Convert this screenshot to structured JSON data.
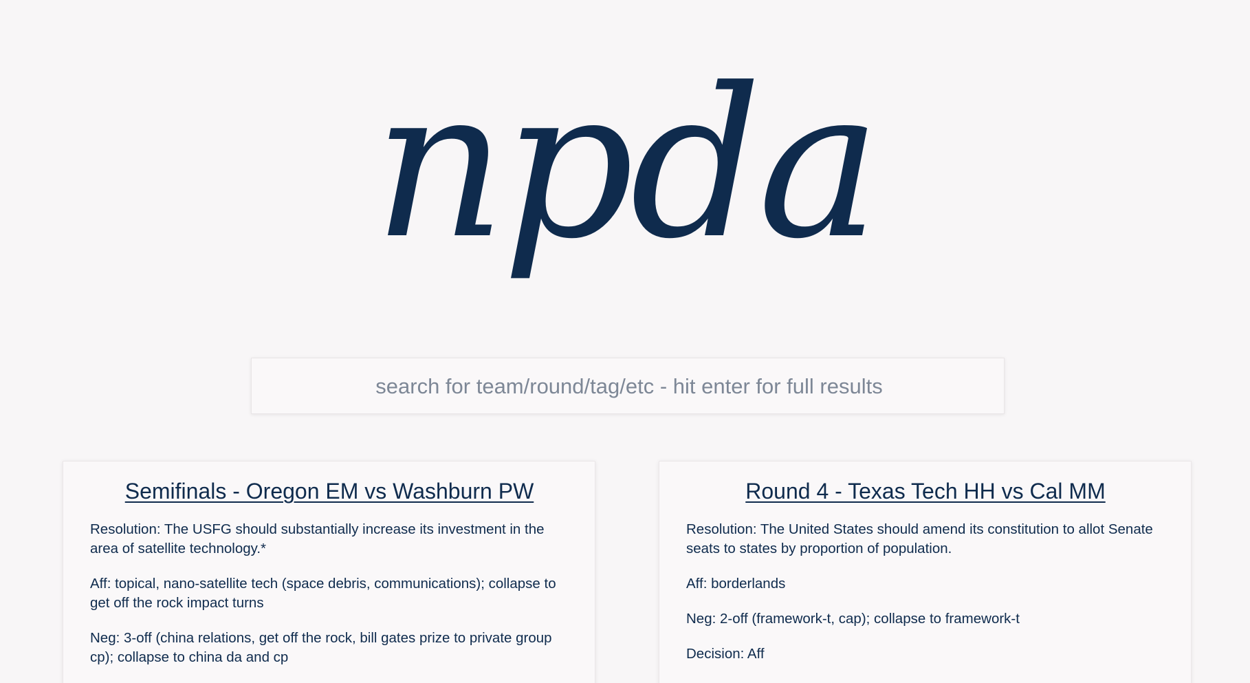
{
  "logo": {
    "text": "npda"
  },
  "search": {
    "placeholder": "search for team/round/tag/etc - hit enter for full results",
    "value": ""
  },
  "cards": [
    {
      "title": "Semifinals - Oregon EM vs Washburn PW",
      "resolution": "Resolution: The USFG should substantially increase its investment in the area of satellite technology.*",
      "aff": "Aff: topical, nano-satellite tech (space debris, communications); collapse to get off the rock impact turns",
      "neg": "Neg: 3-off (china relations, get off the rock, bill gates prize to private group cp); collapse to china da and cp"
    },
    {
      "title": "Round 4 - Texas Tech HH vs Cal MM",
      "resolution": "Resolution: The United States should amend its constitution to allot Senate seats to states by proportion of population.",
      "aff": "Aff: borderlands",
      "neg": "Neg: 2-off (framework-t, cap); collapse to framework-t",
      "decision": "Decision: Aff"
    }
  ]
}
